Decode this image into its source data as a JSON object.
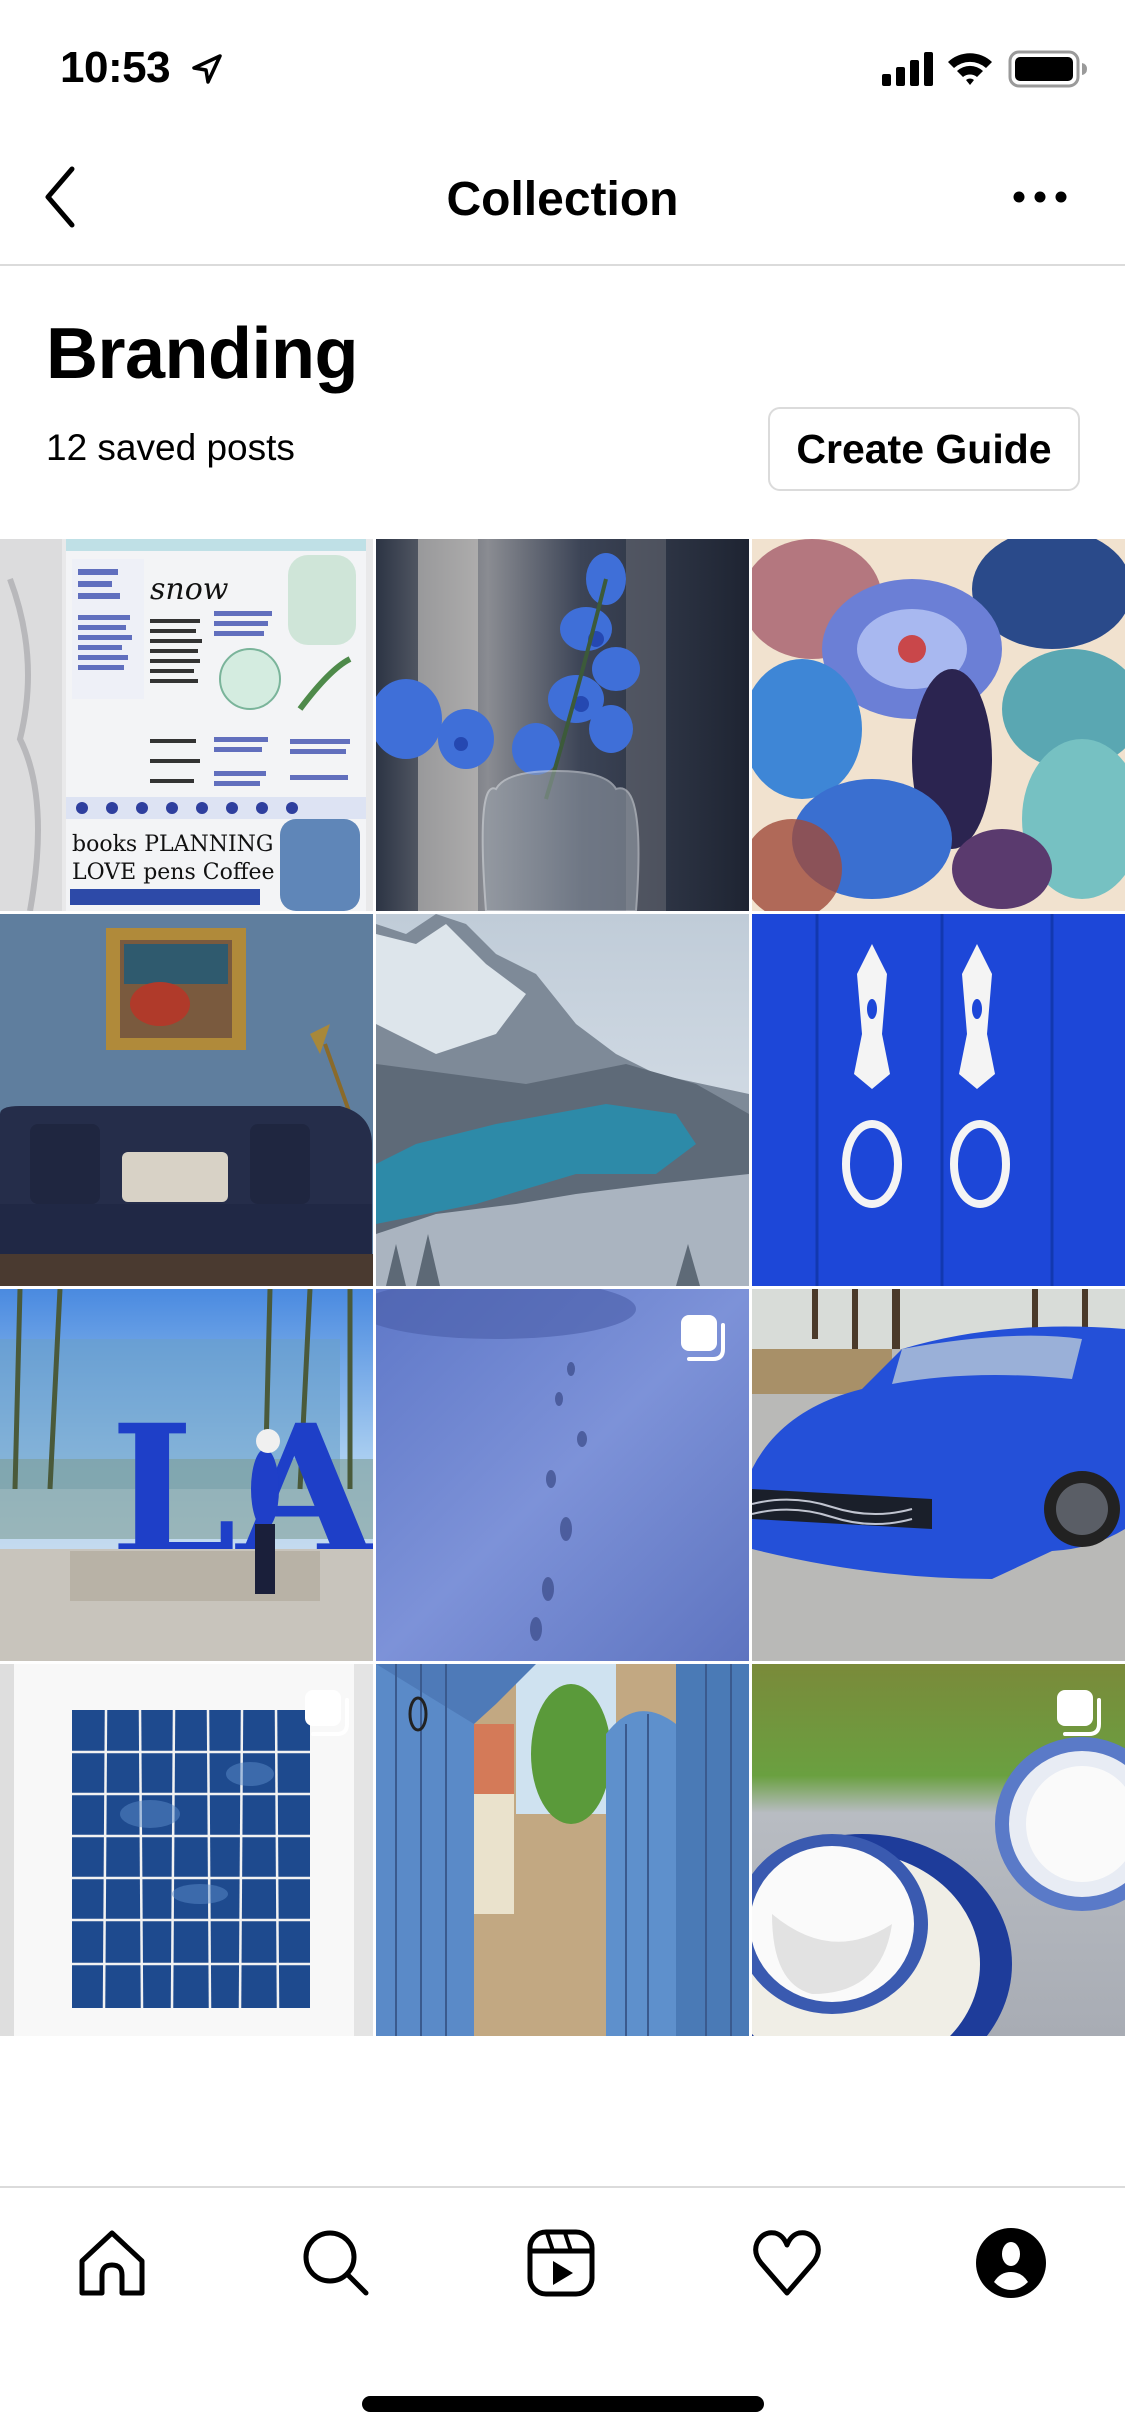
{
  "status_bar": {
    "time": "10:53",
    "icons": [
      "location-arrow-icon",
      "cellular-signal-icon",
      "wifi-icon",
      "battery-icon"
    ]
  },
  "nav": {
    "title": "Collection",
    "back_icon": "chevron-left-icon",
    "more_icon": "more-horizontal-icon"
  },
  "collection": {
    "name": "Branding",
    "saved_count_label": "12 saved posts",
    "create_guide_label": "Create Guide"
  },
  "posts": [
    {
      "subject": "blue planner journal spread",
      "multiple": false
    },
    {
      "subject": "blue orchid in glass vase",
      "multiple": false
    },
    {
      "subject": "blue floral botanical pattern",
      "multiple": false
    },
    {
      "subject": "navy velvet sofa in blue room",
      "multiple": false
    },
    {
      "subject": "turquoise mountain lake in snow",
      "multiple": false
    },
    {
      "subject": "blue door with white knockers",
      "multiple": false
    },
    {
      "subject": "LA sign with person",
      "multiple": false
    },
    {
      "subject": "blue-tinted snow with footprints",
      "multiple": true
    },
    {
      "subject": "blue sports car",
      "multiple": false
    },
    {
      "subject": "cyanotype tile print",
      "multiple": true
    },
    {
      "subject": "blue wooden gate",
      "multiple": false
    },
    {
      "subject": "blue and white dinnerware",
      "multiple": true
    }
  ],
  "tab_bar": {
    "tabs": [
      {
        "name": "home",
        "icon": "home-icon"
      },
      {
        "name": "search",
        "icon": "search-icon"
      },
      {
        "name": "reels",
        "icon": "reels-icon"
      },
      {
        "name": "activity",
        "icon": "heart-icon"
      },
      {
        "name": "profile",
        "icon": "profile-icon"
      }
    ]
  },
  "colors": {
    "divider": "#dbdbdb",
    "text": "#000000",
    "background": "#ffffff"
  }
}
